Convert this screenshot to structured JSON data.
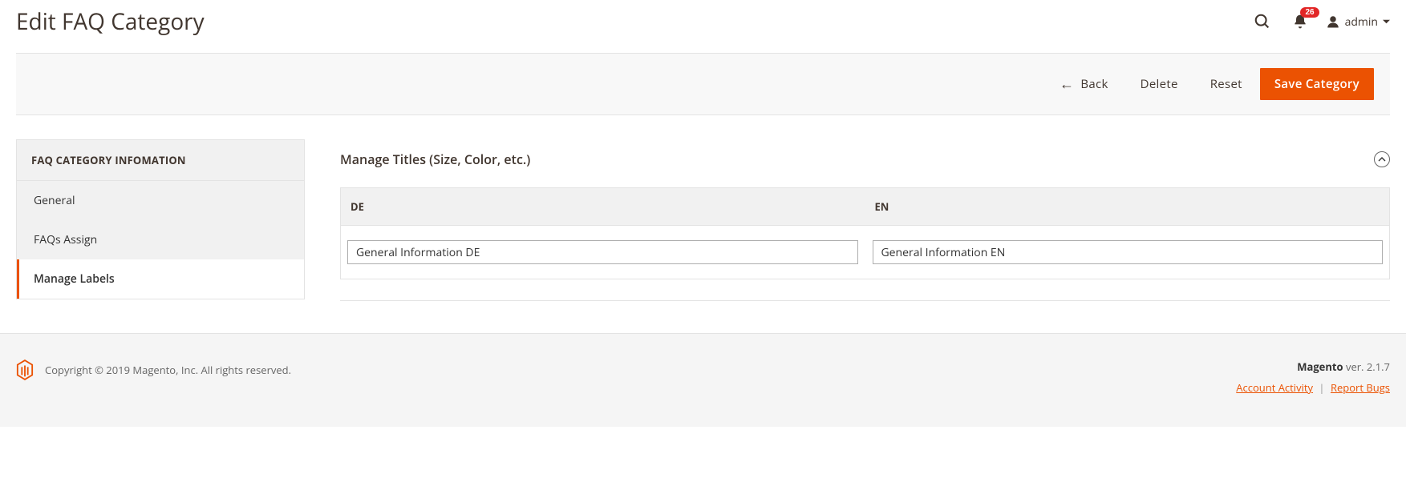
{
  "header": {
    "title": "Edit FAQ Category",
    "notification_count": "26",
    "user": "admin"
  },
  "actions": {
    "back": "Back",
    "delete": "Delete",
    "reset": "Reset",
    "save": "Save Category"
  },
  "sidebar": {
    "title": "FAQ CATEGORY INFOMATION",
    "items": [
      {
        "label": "General"
      },
      {
        "label": "FAQs Assign"
      },
      {
        "label": "Manage Labels"
      }
    ]
  },
  "main": {
    "section_title": "Manage Titles (Size, Color, etc.)",
    "columns": [
      {
        "header": "DE",
        "value": "General Information DE"
      },
      {
        "header": "EN",
        "value": "General Information EN"
      }
    ]
  },
  "footer": {
    "copyright": "Copyright © 2019 Magento, Inc. All rights reserved.",
    "product": "Magento",
    "version_prefix": " ver. ",
    "version": "2.1.7",
    "account_activity": "Account Activity",
    "report_bugs": "Report Bugs"
  }
}
